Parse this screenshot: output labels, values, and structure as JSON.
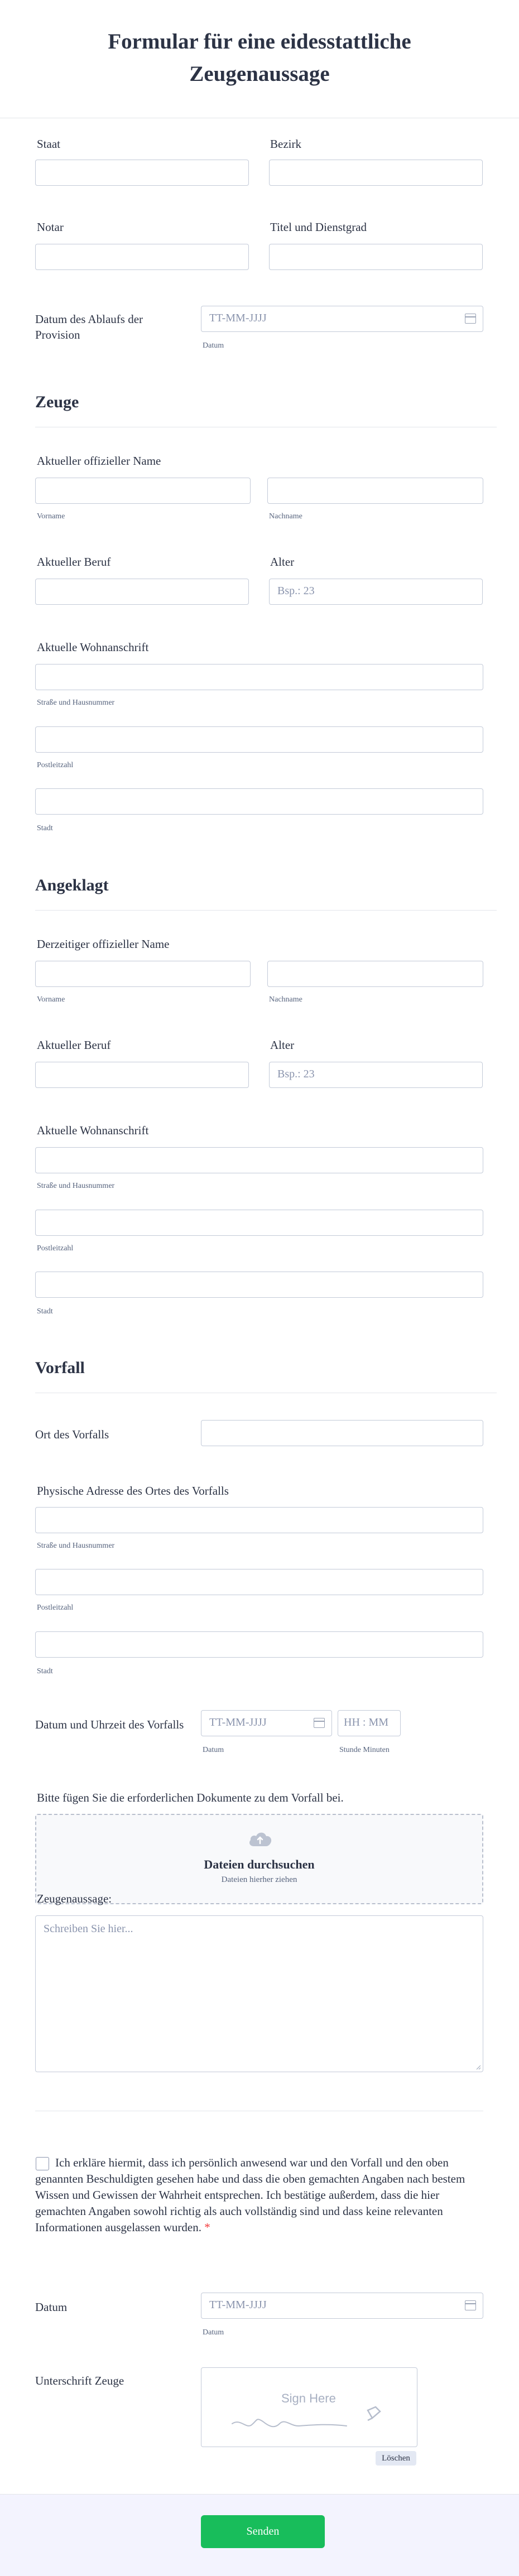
{
  "form": {
    "title_line1": "Formular für eine eidesstattliche",
    "title_line2": "Zeugenaussage"
  },
  "notary": {
    "state_label": "Staat",
    "district_label": "Bezirk",
    "notary_label": "Notar",
    "title_rank_label": "Titel und Dienstgrad",
    "expiry_label_line1": "Datum des Ablaufs der",
    "expiry_label_line2": "Provision",
    "expiry_placeholder": "TT-MM-JJJJ",
    "expiry_sublabel": "Datum"
  },
  "witness": {
    "section_title": "Zeuge",
    "name_label": "Aktueller offizieller Name",
    "first_sub": "Vorname",
    "last_sub": "Nachname",
    "job_label": "Aktueller Beruf",
    "age_label": "Alter",
    "age_placeholder": "Bsp.: 23",
    "address_label": "Aktuelle Wohnanschrift",
    "street_sub": "Straße und Hausnummer",
    "zip_sub": "Postleitzahl",
    "city_sub": "Stadt"
  },
  "defendant": {
    "section_title": "Angeklagt",
    "name_label": "Derzeitiger offizieller Name",
    "first_sub": "Vorname",
    "last_sub": "Nachname",
    "job_label": "Aktueller Beruf",
    "age_label": "Alter",
    "age_placeholder": "Bsp.: 23",
    "address_label": "Aktuelle Wohnanschrift",
    "street_sub": "Straße und Hausnummer",
    "zip_sub": "Postleitzahl",
    "city_sub": "Stadt"
  },
  "incident": {
    "section_title": "Vorfall",
    "location_label": "Ort des Vorfalls",
    "address_label": "Physische Adresse des Ortes des Vorfalls",
    "street_sub": "Straße und Hausnummer",
    "zip_sub": "Postleitzahl",
    "city_sub": "Stadt",
    "datetime_label": "Datum und Uhrzeit des Vorfalls",
    "date_placeholder": "TT-MM-JJJJ",
    "time_placeholder": "HH : MM",
    "date_sub": "Datum",
    "time_sub": "Stunde Minuten",
    "docs_label": "Bitte fügen Sie die erforderlichen Dokumente zu dem Vorfall bei.",
    "upload_title": "Dateien durchsuchen",
    "upload_sub": "Dateien hierher ziehen",
    "statement_label": "Zeugenaussage:",
    "statement_placeholder": "Schreiben Sie hier..."
  },
  "declaration": {
    "text": "Ich erkläre hiermit, dass ich persönlich anwesend war und den Vorfall und den oben genannten Beschuldigten gesehen habe und dass die oben gemachten Angaben nach bestem Wissen und Gewissen der Wahrheit entsprechen. Ich bestätige außerdem, dass die hier gemachten Angaben sowohl richtig als auch vollständig sind und dass keine relevanten Informationen ausgelassen wurden.",
    "required_mark": "*",
    "date_label": "Datum",
    "date_placeholder": "TT-MM-JJJJ",
    "date_sub": "Datum",
    "signature_label": "Unterschrift Zeuge",
    "signature_hint": "Sign Here",
    "clear_label": "Löschen"
  },
  "footer": {
    "submit_label": "Senden"
  },
  "colors": {
    "submit": "#18bd5b",
    "text": "#2c3345",
    "border": "#c3cad8",
    "required": "#f23a3c"
  }
}
